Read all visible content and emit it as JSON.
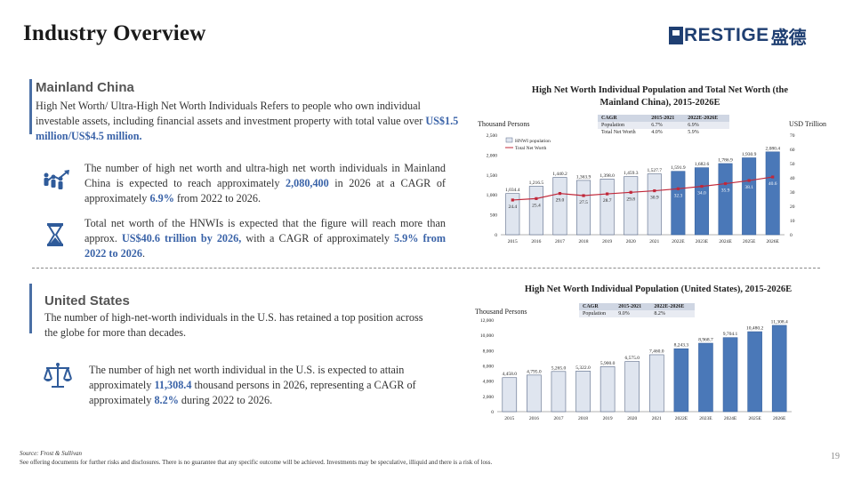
{
  "header": {
    "title": "Industry Overview",
    "logo_text": "RESTIGE",
    "logo_cn": "盛德"
  },
  "china": {
    "title": "Mainland China",
    "intro_text": "High Net Worth/ Ultra-High Net Worth Individuals Refers to people who own individual investable assets, including financial assets and investment property with total value over",
    "intro_hl": "US$1.5 million/US$4.5 million.",
    "p1_a": "The number of high net worth and ultra-high net worth individuals in Mainland China is expected to reach approximately",
    "p1_hl1": "2,080,400",
    "p1_b": "in 2026 at a CAGR of approximately",
    "p1_hl2": "6.9%",
    "p1_c": "from 2022 to 2026.",
    "p2_a": "Total net worth of the HNWIs is expected that the figure will reach more than approx.",
    "p2_hl1": "US$40.6 trillion by 2026,",
    "p2_b": "with a CAGR of approximately",
    "p2_hl2": "5.9% from 2022 to 2026",
    "p2_c": "."
  },
  "us": {
    "title": "United States",
    "intro": "The number of high-net-worth individuals in the U.S. has retained a top position across the globe for more than decades.",
    "p1_a": "The number of high net worth individual in the U.S. is expected to attain approximately",
    "p1_hl1": "11,308.4",
    "p1_b": "thousand persons in 2026, representing a CAGR of approximately",
    "p1_hl2": "8.2%",
    "p1_c": "during 2022 to 2026."
  },
  "chart_data": [
    {
      "type": "bar",
      "title": "High Net Worth Individual Population and Total Net Worth (the Mainland China), 2015-2026E",
      "ylabel": "Thousand Persons",
      "y2label": "USD Trillion",
      "categories": [
        "2015",
        "2016",
        "2017",
        "2018",
        "2019",
        "2020",
        "2021",
        "2022E",
        "2023E",
        "2024E",
        "2025E",
        "2026E"
      ],
      "series": [
        {
          "name": "HNWI population",
          "kind": "bar",
          "values": [
            1034.4,
            1216.5,
            1440.2,
            1363.9,
            1398.0,
            1459.3,
            1527.7,
            1591.9,
            1682.6,
            1786.9,
            1930.9,
            2080.4
          ]
        },
        {
          "name": "Total Net Worth",
          "kind": "line",
          "axis": "right",
          "values": [
            24.4,
            25.4,
            29.0,
            27.5,
            28.7,
            29.8,
            30.9,
            32.3,
            34.0,
            35.9,
            38.1,
            40.6
          ]
        }
      ],
      "ylim": [
        0,
        2500
      ],
      "yticks": [
        "0",
        "500",
        "1,000",
        "1,500",
        "2,000",
        "2,500"
      ],
      "y2lim": [
        0,
        70
      ],
      "y2ticks": [
        "0",
        "10",
        "20",
        "30",
        "40",
        "50",
        "60",
        "70"
      ],
      "value_labels": [
        "1,034.4",
        "1,216.5",
        "1,440.2",
        "1,363.9",
        "1,398.0",
        "1,459.3",
        "1,527.7",
        "1,591.9",
        "1,682.6",
        "1,786.9",
        "1,930.9",
        "2,080.4"
      ],
      "line_labels": [
        "24.4",
        "25.4",
        "29.0",
        "27.5",
        "28.7",
        "29.8",
        "30.9",
        "32.3",
        "34.0",
        "35.9",
        "38.1",
        "40.6"
      ],
      "cagr_table": {
        "header": [
          "CAGR",
          "2015-2021",
          "2022E-2026E"
        ],
        "rows": [
          [
            "Population",
            "6.7%",
            "6.9%"
          ],
          [
            "Total Net Worth",
            "4.0%",
            "5.9%"
          ]
        ]
      },
      "colors": {
        "historical": "#dfe5ef",
        "forecast": "#4a78b8",
        "line": "#c0283a"
      }
    },
    {
      "type": "bar",
      "title": "High Net Worth Individual Population (United States), 2015-2026E",
      "ylabel": "Thousand Persons",
      "categories": [
        "2015",
        "2016",
        "2017",
        "2018",
        "2019",
        "2020",
        "2021",
        "2022E",
        "2023E",
        "2024E",
        "2025E",
        "2026E"
      ],
      "series": [
        {
          "name": "HNWI population",
          "kind": "bar",
          "values": [
            4458.0,
            4795.0,
            5265.0,
            5322.0,
            5900.0,
            6575.0,
            7460.0,
            8243.3,
            8968.7,
            9704.1,
            10480.2,
            11308.4
          ]
        }
      ],
      "ylim": [
        0,
        12000
      ],
      "yticks": [
        "0",
        "2,000",
        "4,000",
        "6,000",
        "8,000",
        "10,000",
        "12,000"
      ],
      "value_labels": [
        "4,458.0",
        "4,795.0",
        "5,265.0",
        "5,322.0",
        "5,900.0",
        "6,575.0",
        "7,460.0",
        "8,243.3",
        "8,968.7",
        "9,704.1",
        "10,480.2",
        "11,308.4"
      ],
      "cagr_table": {
        "header": [
          "CAGR",
          "2015-2021",
          "2022E-2026E"
        ],
        "rows": [
          [
            "Population",
            "9.0%",
            "8.2%"
          ]
        ]
      },
      "colors": {
        "historical": "#dfe5ef",
        "forecast": "#4a78b8"
      }
    }
  ],
  "footer": {
    "source": "Source: Frost & Sullivan",
    "disclaimer": "See offering documents for further risks and disclosures. There is no guarantee that any specific outcome will be achieved. Investments may be speculative, illiquid and there is a risk of loss.",
    "page": "19"
  }
}
